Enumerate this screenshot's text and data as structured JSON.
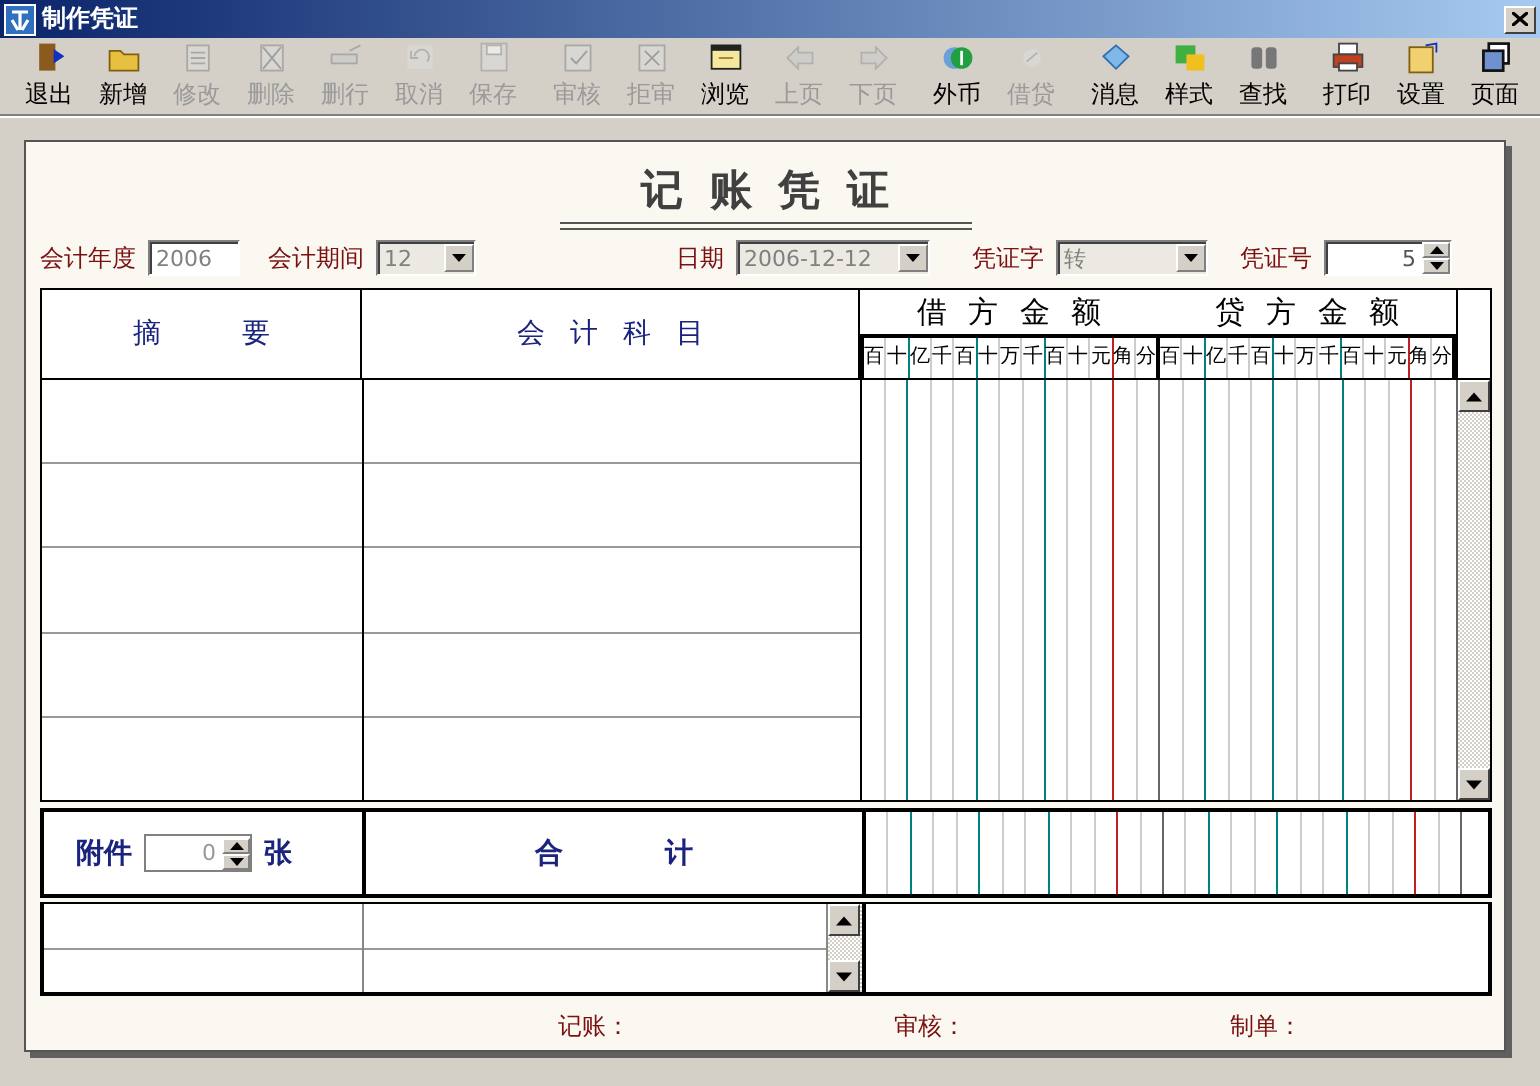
{
  "window": {
    "title": "制作凭证"
  },
  "toolbar": [
    {
      "label": "退出",
      "disabled": false,
      "separator_before": false
    },
    {
      "label": "新增",
      "disabled": false,
      "separator_before": false
    },
    {
      "label": "修改",
      "disabled": true,
      "separator_before": false
    },
    {
      "label": "删除",
      "disabled": true,
      "separator_before": false
    },
    {
      "label": "删行",
      "disabled": true,
      "separator_before": false
    },
    {
      "label": "取消",
      "disabled": true,
      "separator_before": false
    },
    {
      "label": "保存",
      "disabled": true,
      "separator_before": false
    },
    {
      "label": "审核",
      "disabled": true,
      "separator_before": true
    },
    {
      "label": "拒审",
      "disabled": true,
      "separator_before": false
    },
    {
      "label": "浏览",
      "disabled": false,
      "separator_before": false
    },
    {
      "label": "上页",
      "disabled": true,
      "separator_before": false
    },
    {
      "label": "下页",
      "disabled": true,
      "separator_before": false
    },
    {
      "label": "外币",
      "disabled": false,
      "separator_before": true
    },
    {
      "label": "借贷",
      "disabled": true,
      "separator_before": false
    },
    {
      "label": "消息",
      "disabled": false,
      "separator_before": true
    },
    {
      "label": "样式",
      "disabled": false,
      "separator_before": false
    },
    {
      "label": "查找",
      "disabled": false,
      "separator_before": false
    },
    {
      "label": "打印",
      "disabled": false,
      "separator_before": true
    },
    {
      "label": "设置",
      "disabled": false,
      "separator_before": false
    },
    {
      "label": "页面",
      "disabled": false,
      "separator_before": false
    }
  ],
  "voucher": {
    "title": "记 账 凭 证",
    "fields": [
      {
        "kind": "text",
        "label": "会计年度",
        "value": "2006",
        "disabled": false
      },
      {
        "kind": "combo",
        "label": "会计期间",
        "value": "12",
        "disabled": true
      },
      {
        "kind": "combo",
        "label": "日期",
        "value": "2006-12-12",
        "disabled": true
      },
      {
        "kind": "combo",
        "label": "凭证字",
        "value": "转",
        "disabled": true
      },
      {
        "kind": "spin",
        "label": "凭证号",
        "value": "5",
        "disabled": false
      }
    ],
    "columns": {
      "summary": "摘 要",
      "account": "会 计 科 目",
      "debit": "借 方 金 额",
      "credit": "贷 方 金 额"
    },
    "debit_units": [
      "百",
      "十",
      "亿",
      "千",
      "百",
      "十",
      "万",
      "千",
      "百",
      "十",
      "元",
      "角",
      "分"
    ],
    "credit_units": [
      "百",
      "十",
      "亿",
      "千",
      "百",
      "十",
      "万",
      "千",
      "百",
      "十",
      "元",
      "角",
      "分"
    ],
    "attachments_label": "附件",
    "attachments_value": "0",
    "attachments_unit": "张",
    "total_label": "合 计",
    "signatures": [
      "记账：",
      "审核：",
      "制单："
    ]
  }
}
